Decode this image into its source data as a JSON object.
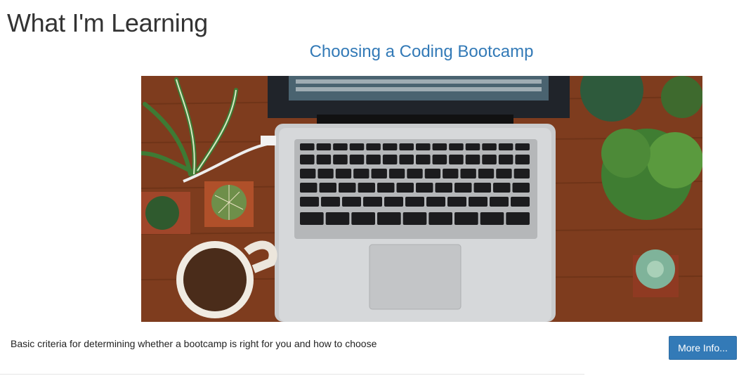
{
  "page": {
    "title": "What I'm Learning"
  },
  "card": {
    "title": "Choosing a Coding Bootcamp",
    "image_alt": "laptop-on-wooden-desk-with-plants-and-coffee-photo",
    "description": "Basic criteria for determining whether a bootcamp is right for you and how to choose",
    "button_label": "More Info..."
  },
  "colors": {
    "link": "#337ab7",
    "button": "#337ab7",
    "button_text": "#ffffff",
    "heading": "#333333"
  }
}
